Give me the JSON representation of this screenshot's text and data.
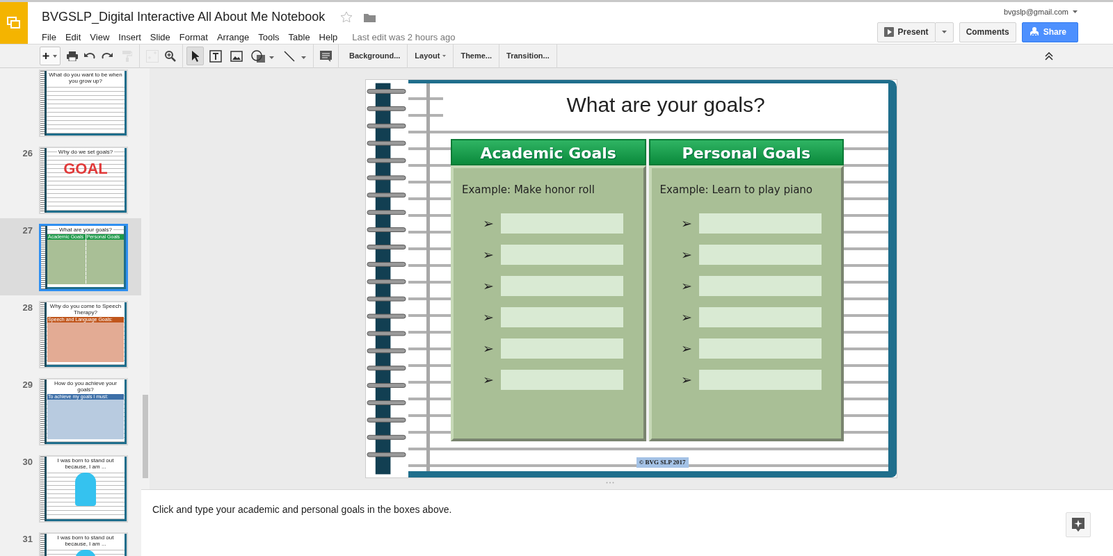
{
  "document": {
    "title": "BVGSLP_Digital Interactive All About Me Notebook",
    "starred": false
  },
  "menu": [
    "File",
    "Edit",
    "View",
    "Insert",
    "Slide",
    "Format",
    "Arrange",
    "Tools",
    "Table",
    "Help"
  ],
  "last_edit": "Last edit was 2 hours ago",
  "account": "bvgslp@gmail.com",
  "actions": [
    {
      "kind": "present",
      "label": "Present"
    },
    {
      "kind": "comments",
      "label": "Comments"
    },
    {
      "kind": "share",
      "label": "Share"
    }
  ],
  "tools": [
    {
      "kind": "new-slide",
      "selected": false,
      "disabled": false
    },
    {
      "kind": "print",
      "selected": false,
      "disabled": false
    },
    {
      "kind": "undo",
      "selected": false,
      "disabled": false
    },
    {
      "kind": "redo",
      "selected": false,
      "disabled": false
    },
    {
      "kind": "paint-format",
      "selected": false,
      "disabled": true
    },
    {
      "kind": "arrange",
      "selected": false,
      "disabled": true
    },
    {
      "kind": "zoom",
      "selected": false,
      "disabled": false
    },
    {
      "kind": "select",
      "selected": true,
      "disabled": false
    },
    {
      "kind": "text-box",
      "selected": false,
      "disabled": false
    },
    {
      "kind": "image",
      "selected": false,
      "disabled": false
    },
    {
      "kind": "shape",
      "selected": false,
      "disabled": false
    },
    {
      "kind": "line",
      "selected": false,
      "disabled": false
    },
    {
      "kind": "comment",
      "selected": false,
      "disabled": false
    }
  ],
  "toolbar_buttons": [
    {
      "label": "Background...",
      "dropdown": false
    },
    {
      "label": "Layout",
      "dropdown": true
    },
    {
      "label": "Theme...",
      "dropdown": false
    },
    {
      "label": "Transition...",
      "dropdown": false
    }
  ],
  "filmstrip": [
    {
      "kind": "lines",
      "title": "What do you want to be when you grow up?",
      "selected": false
    },
    {
      "number": "26",
      "kind": "goal",
      "title": "Why do we set goals?",
      "art_text": "GOAL",
      "selected": false
    },
    {
      "number": "27",
      "kind": "table",
      "title": "What are your goals?",
      "headings": [
        "Academic Goals",
        "Personal Goals"
      ],
      "color": "#1e9a4a",
      "selected": true
    },
    {
      "number": "28",
      "kind": "table",
      "title": "Why do you come to Speech Therapy?",
      "headings": [
        "Speech and Language Goals:"
      ],
      "color": "#c0561c",
      "selected": false
    },
    {
      "number": "29",
      "kind": "table",
      "title": "How do you achieve your goals?",
      "headings": [
        "To achieve my goals I must:"
      ],
      "color": "#3d6fa8",
      "selected": false
    },
    {
      "number": "30",
      "kind": "portrait",
      "title": "I was born to stand out because, I am ...",
      "selected": false
    },
    {
      "number": "31",
      "kind": "portrait",
      "title": "I was born to stand out because, I am ...",
      "selected": false
    }
  ],
  "slide": {
    "title": "What are your goals?",
    "columns": [
      {
        "heading": "Academic Goals",
        "example": "Example: Make honor roll",
        "bullets": [
          "➢",
          "➢",
          "➢",
          "➢",
          "➢",
          "➢"
        ]
      },
      {
        "heading": "Personal Goals",
        "example": "Example: Learn to play piano",
        "bullets": [
          "➢",
          "➢",
          "➢",
          "➢",
          "➢",
          "➢"
        ]
      }
    ],
    "copyright": "© BVG SLP 2017"
  },
  "notes": "Click and type your academic and personal goals in the boxes above."
}
